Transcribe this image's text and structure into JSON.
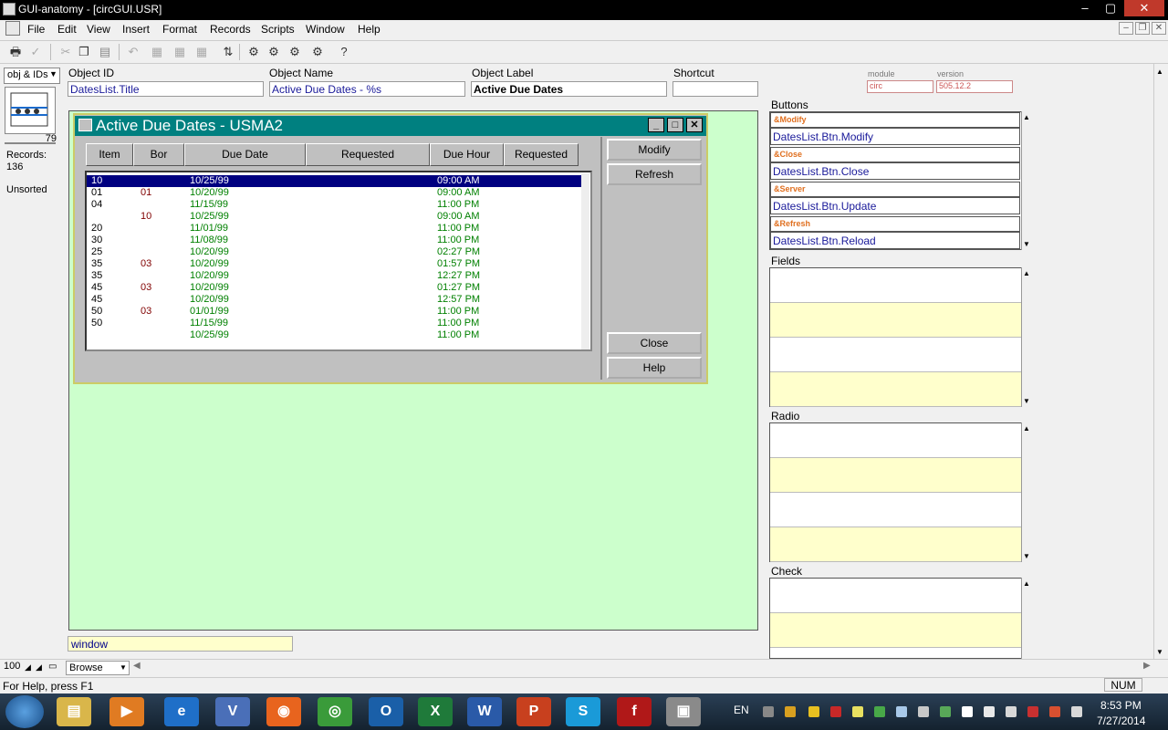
{
  "window": {
    "title": "GUI-anatomy - [circGUI.USR]",
    "minimize": "–",
    "maximize": "▢",
    "close": "✕"
  },
  "menu": [
    "File",
    "Edit",
    "View",
    "Insert",
    "Format",
    "Records",
    "Scripts",
    "Window",
    "Help"
  ],
  "mdi": {
    "minimize": "–",
    "restore": "❐",
    "close": "✕"
  },
  "left": {
    "dropdown": "obj & IDs",
    "record_count": "79",
    "records_label": "Records:",
    "records_value": "136",
    "sort_state": "Unsorted"
  },
  "props": {
    "object_id_label": "Object ID",
    "object_id": "DatesList.Title",
    "object_name_label": "Object Name",
    "object_name": "Active Due Dates - %s",
    "object_label_label": "Object Label",
    "object_label": "Active Due Dates",
    "shortcut_label": "Shortcut",
    "shortcut": "",
    "module_label": "module",
    "module": "circ",
    "version_label": "version",
    "version": "505.12.2"
  },
  "dialog": {
    "title": "Active Due Dates - USMA2",
    "columns": [
      "Item",
      "Bor",
      "Due Date",
      "Requested",
      "Due Hour",
      "Requested"
    ],
    "rows": [
      {
        "item": "10",
        "bor": "",
        "date": "10/25/99",
        "hour": "09:00 AM"
      },
      {
        "item": "01",
        "bor": "01",
        "date": "10/20/99",
        "hour": "09:00 AM"
      },
      {
        "item": "04",
        "bor": "",
        "date": "11/15/99",
        "hour": "11:00 PM"
      },
      {
        "item": "",
        "bor": "10",
        "date": "10/25/99",
        "hour": "09:00 AM"
      },
      {
        "item": "20",
        "bor": "",
        "date": "11/01/99",
        "hour": "11:00 PM"
      },
      {
        "item": "30",
        "bor": "",
        "date": "11/08/99",
        "hour": "11:00 PM"
      },
      {
        "item": "25",
        "bor": "",
        "date": "10/20/99",
        "hour": "02:27 PM"
      },
      {
        "item": "35",
        "bor": "03",
        "date": "10/20/99",
        "hour": "01:57 PM"
      },
      {
        "item": "35",
        "bor": "",
        "date": "10/20/99",
        "hour": "12:27 PM"
      },
      {
        "item": "45",
        "bor": "03",
        "date": "10/20/99",
        "hour": "01:27 PM"
      },
      {
        "item": "45",
        "bor": "",
        "date": "10/20/99",
        "hour": "12:57 PM"
      },
      {
        "item": "50",
        "bor": "03",
        "date": "01/01/99",
        "hour": "11:00 PM"
      },
      {
        "item": "50",
        "bor": "",
        "date": "11/15/99",
        "hour": "11:00 PM"
      },
      {
        "item": "",
        "bor": "",
        "date": "10/25/99",
        "hour": "11:00 PM"
      }
    ],
    "buttons": {
      "modify": "Modify",
      "refresh": "Refresh",
      "close": "Close",
      "help": "Help"
    }
  },
  "window_field": "window",
  "panel": {
    "buttons_label": "Buttons",
    "buttons": [
      {
        "label": "&Modify",
        "value": "DatesList.Btn.Modify"
      },
      {
        "label": "&Close",
        "value": "DatesList.Btn.Close"
      },
      {
        "label": "&Server",
        "value": "DatesList.Btn.Update"
      },
      {
        "label": "&Refresh",
        "value": "DatesList.Btn.Reload"
      }
    ],
    "fields_label": "Fields",
    "radio_label": "Radio",
    "check_label": "Check"
  },
  "bottom": {
    "zoom": "100",
    "mode": "Browse",
    "status": "For Help, press F1",
    "num": "NUM"
  },
  "taskbar": {
    "lang": "EN",
    "time": "8:53 PM",
    "date": "7/27/2014"
  },
  "colors": {
    "canvas": "#ccffcc",
    "dialog_title": "#008080",
    "selection": "#000080",
    "date_text": "#008000",
    "bor_text": "#800000",
    "button_label": "#e07020"
  }
}
